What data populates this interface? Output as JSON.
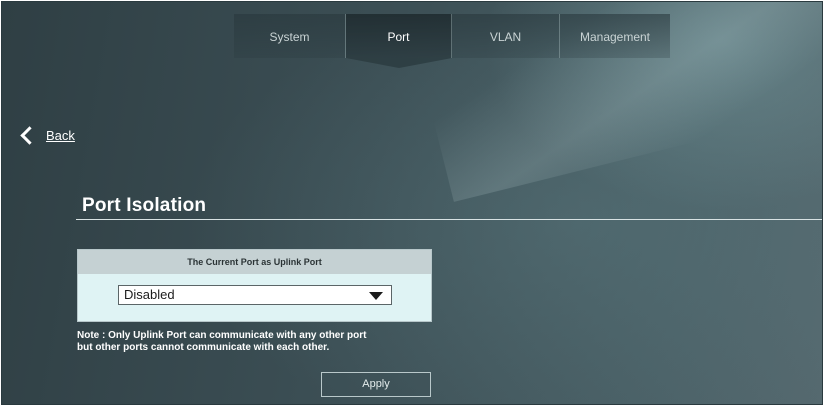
{
  "nav": {
    "tabs": [
      {
        "label": "System"
      },
      {
        "label": "Port",
        "active": true
      },
      {
        "label": "VLAN"
      },
      {
        "label": "Management"
      }
    ]
  },
  "back": {
    "label": "Back",
    "icon": "chevron-left-icon"
  },
  "section": {
    "title": "Port Isolation"
  },
  "uplink": {
    "header": "The Current Port as Uplink Port",
    "select_value": "Disabled"
  },
  "note": {
    "line1": "Note : Only Uplink Port can communicate with any other port",
    "line2": "but other ports cannot communicate with each other."
  },
  "actions": {
    "apply_label": "Apply"
  }
}
